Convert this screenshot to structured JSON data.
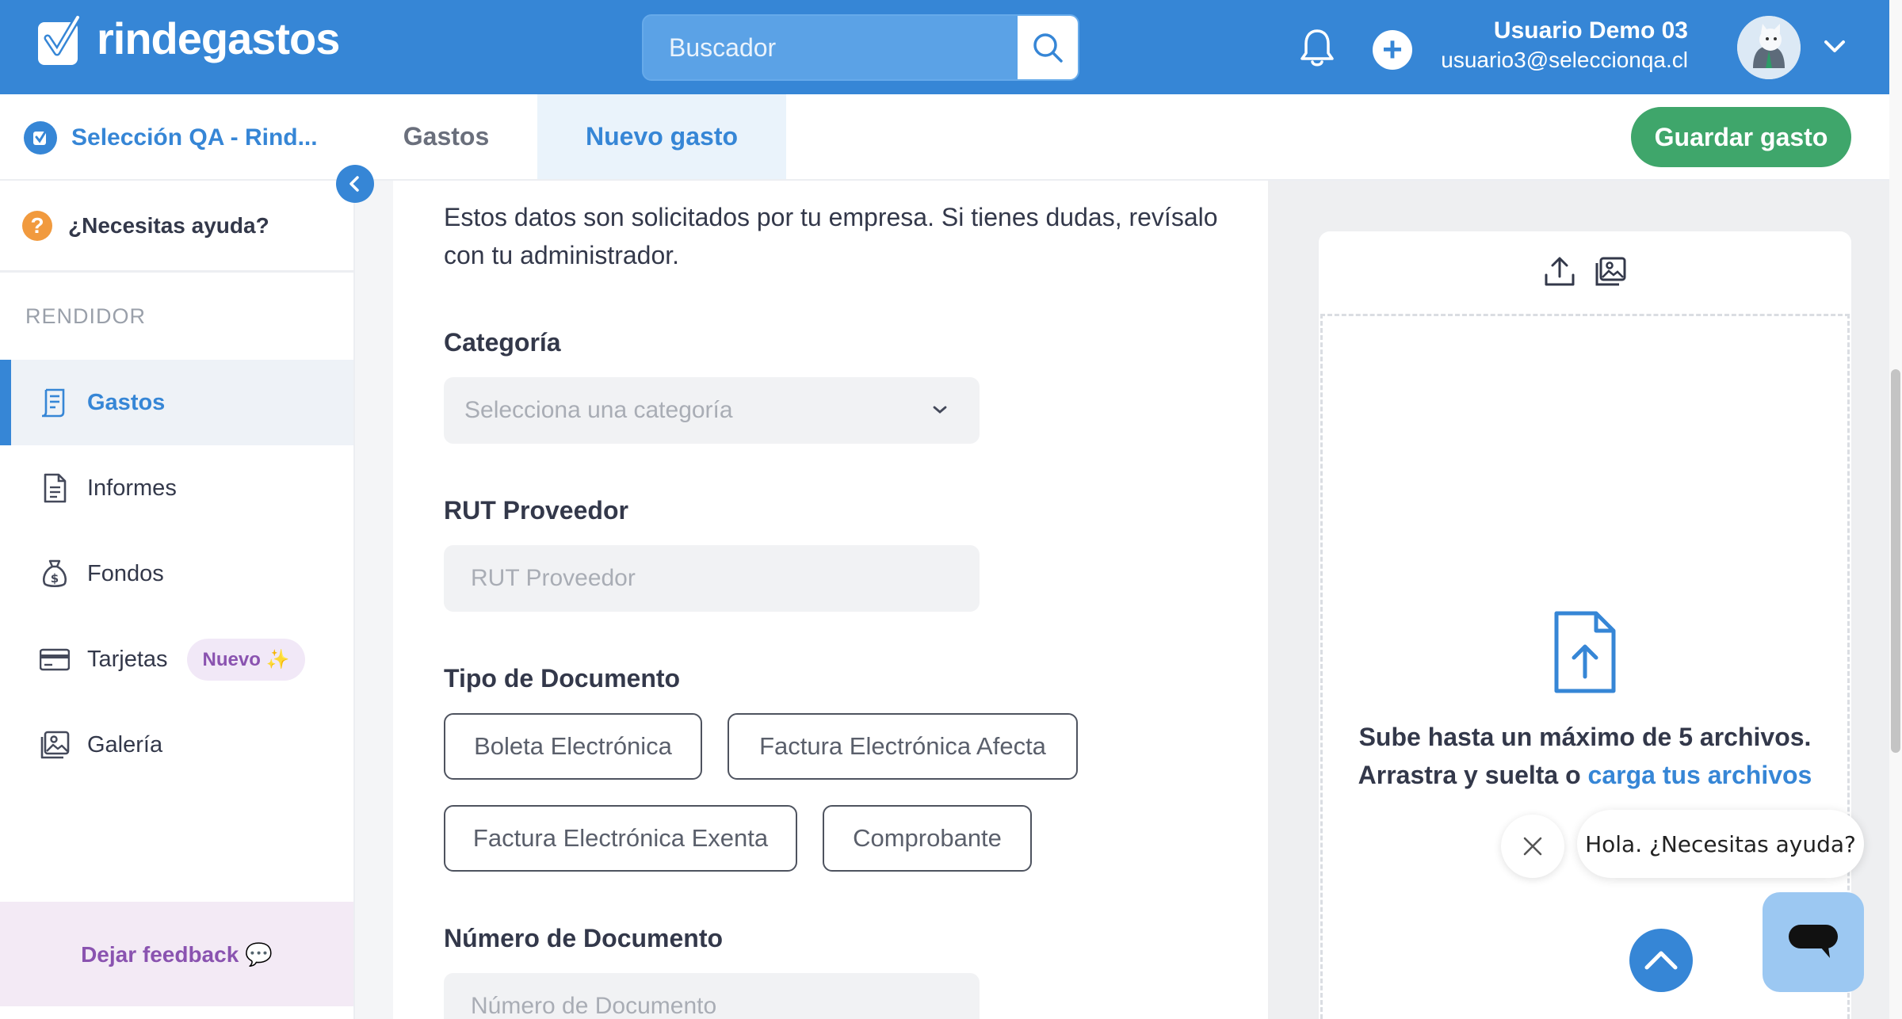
{
  "brand": {
    "name": "rindegastos"
  },
  "search": {
    "placeholder": "Buscador"
  },
  "user": {
    "name": "Usuario Demo 03",
    "email": "usuario3@seleccionqa.cl"
  },
  "header": {
    "company": "Selección QA - Rind...",
    "tabs": [
      {
        "label": "Gastos",
        "active": false
      },
      {
        "label": "Nuevo gasto",
        "active": true
      }
    ],
    "save_label": "Guardar gasto"
  },
  "sidebar": {
    "help_label": "¿Necesitas ayuda?",
    "section": "RENDIDOR",
    "items": [
      {
        "label": "Gastos",
        "icon": "receipt-icon",
        "active": true
      },
      {
        "label": "Informes",
        "icon": "document-icon"
      },
      {
        "label": "Fondos",
        "icon": "money-bag-icon"
      },
      {
        "label": "Tarjetas",
        "icon": "credit-card-icon",
        "badge": "Nuevo ✨"
      },
      {
        "label": "Galería",
        "icon": "gallery-icon"
      }
    ],
    "feedback_label": "Dejar feedback 💬"
  },
  "form": {
    "intro": "Estos datos son solicitados por tu empresa. Si tienes dudas, revísalo con tu administrador.",
    "categoria": {
      "label": "Categoría",
      "placeholder": "Selecciona una categoría"
    },
    "rut": {
      "label": "RUT Proveedor",
      "placeholder": "RUT Proveedor"
    },
    "tipo_documento": {
      "label": "Tipo de Documento",
      "options": [
        "Boleta Electrónica",
        "Factura Electrónica Afecta",
        "Factura Electrónica Exenta",
        "Comprobante"
      ]
    },
    "numero_documento": {
      "label": "Número de Documento",
      "placeholder": "Número de Documento"
    }
  },
  "upload": {
    "line1": "Sube hasta un máximo de 5 archivos.",
    "line2_prefix": "Arrastra y suelta o ",
    "line2_link": "carga tus archivos"
  },
  "chat": {
    "greeting": "Hola. ¿Necesitas ayuda?"
  },
  "colors": {
    "brand": "#3686d6",
    "save": "#3fa66b",
    "feedback": "#8a53b0",
    "help": "#f19a3e"
  }
}
